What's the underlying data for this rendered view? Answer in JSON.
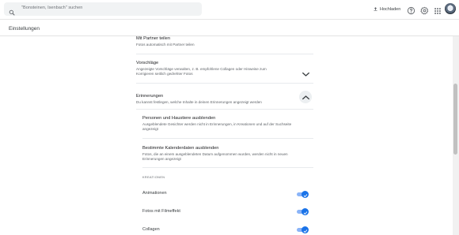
{
  "search": {
    "placeholder": "\"Bonsteinen, Isenbach\" suchen"
  },
  "header": {
    "upload_label": "Hochladen"
  },
  "page": {
    "title": "Einstellungen"
  },
  "settings": {
    "partner": {
      "title": "Mit Partner teilen",
      "description": "Fotos automatisch mit Partner teilen"
    },
    "suggestions": {
      "title": "Vorschläge",
      "description_line1": "Angezeigte Vorschläge verwalten, z. B. empfohlene Collagen oder Hinweise zum",
      "description_line2": "Korrigieren seitlich gedrehter Fotos"
    },
    "memories": {
      "title": "Erinnerungen",
      "description": "Du kannst festlegen, welche Inhalte in deinen Erinnerungen angezeigt werden",
      "sub_people": {
        "title": "Personen und Haustiere ausblenden",
        "description_line1": "Ausgeblendete Gesichter werden nicht in Erinnerungen, in Kreationen und auf der Suchseite",
        "description_line2": "angezeigt"
      },
      "sub_dates": {
        "title": "Bestimmte Kalenderdaten ausblenden",
        "description_line1": "Fotos, die an einem ausgeblendeten Datum aufgenommen wurden, werden nicht in neuen",
        "description_line2": "Erinnerungen angezeigt"
      }
    },
    "creations": {
      "section_label": "KREATIONEN",
      "items": [
        {
          "label": "Animationen",
          "enabled": true
        },
        {
          "label": "Fotos mit Filmeffekt",
          "enabled": true
        },
        {
          "label": "Collagen",
          "enabled": true
        }
      ]
    }
  },
  "colors": {
    "accent": "#1a73e8",
    "toggle_track": "#8ab4f8",
    "search_bg": "#f1f3f4"
  },
  "icons": {
    "search": "search-icon",
    "upload": "upload-icon",
    "help": "help-icon",
    "settings": "gear-icon",
    "apps": "apps-grid-icon",
    "expand": "chevron-down-icon",
    "collapse": "chevron-up-icon",
    "toggle_check": "check-icon"
  }
}
